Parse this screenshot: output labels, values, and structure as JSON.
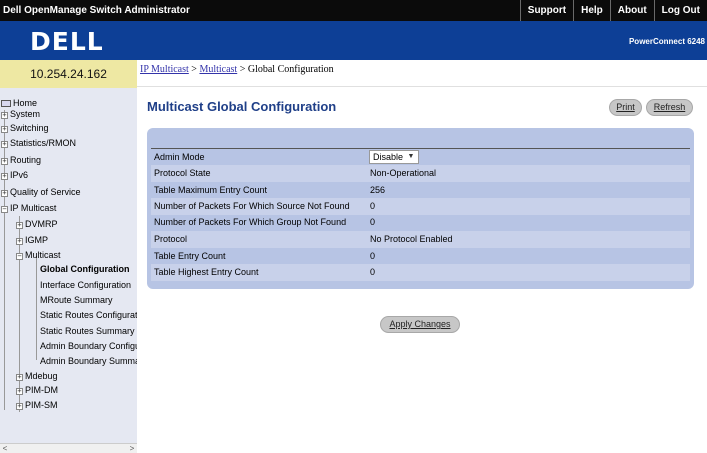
{
  "app": {
    "title": "Dell OpenManage Switch Administrator",
    "top_links": [
      "Support",
      "Help",
      "About",
      "Log Out"
    ],
    "logo": "DELL",
    "product": "PowerConnect 6248"
  },
  "ip_address": "10.254.24.162",
  "breadcrumb": {
    "link1": "IP Multicast",
    "sep1": " > ",
    "link2": "Multicast",
    "sep2": " > ",
    "current": "Global Configuration"
  },
  "sidebar": {
    "home": "Home",
    "items": {
      "system": "System",
      "switching": "Switching",
      "statistics": "Statistics/RMON",
      "routing": "Routing",
      "ipv6": "IPv6",
      "qos": "Quality of Service",
      "ip_multicast": "IP Multicast",
      "dvmrp": "DVMRP",
      "igmp": "IGMP",
      "multicast": "Multicast",
      "global_config": "Global Configuration",
      "interface_config": "Interface Configuration",
      "mroute_summary": "MRoute Summary",
      "static_routes_config": "Static Routes Configuration",
      "static_routes_summary": "Static Routes Summary",
      "admin_boundary_config": "Admin Boundary Configuration",
      "admin_boundary_summary": "Admin Boundary Summary",
      "mdebug": "Mdebug",
      "pim_dm": "PIM-DM",
      "pim_sm": "PIM-SM"
    }
  },
  "main": {
    "title": "Multicast Global Configuration",
    "print_label": "Print",
    "refresh_label": "Refresh",
    "apply_label": "Apply Changes",
    "admin_mode_label": "Admin Mode",
    "admin_mode_value": "Disable",
    "rows": [
      {
        "label": "Protocol State",
        "value": "Non-Operational"
      },
      {
        "label": "Table Maximum Entry Count",
        "value": "256"
      },
      {
        "label": "Number of Packets For Which Source Not Found",
        "value": "0"
      },
      {
        "label": "Number of Packets For Which Group Not Found",
        "value": "0"
      },
      {
        "label": "Protocol",
        "value": "No Protocol Enabled"
      },
      {
        "label": "Table Entry Count",
        "value": "0"
      },
      {
        "label": "Table Highest Entry Count",
        "value": "0"
      }
    ]
  },
  "colors": {
    "banner": "#0d3f96",
    "ip_bar": "#eee8a3",
    "panel": "#b7c4e4",
    "title": "#1f3f88"
  }
}
